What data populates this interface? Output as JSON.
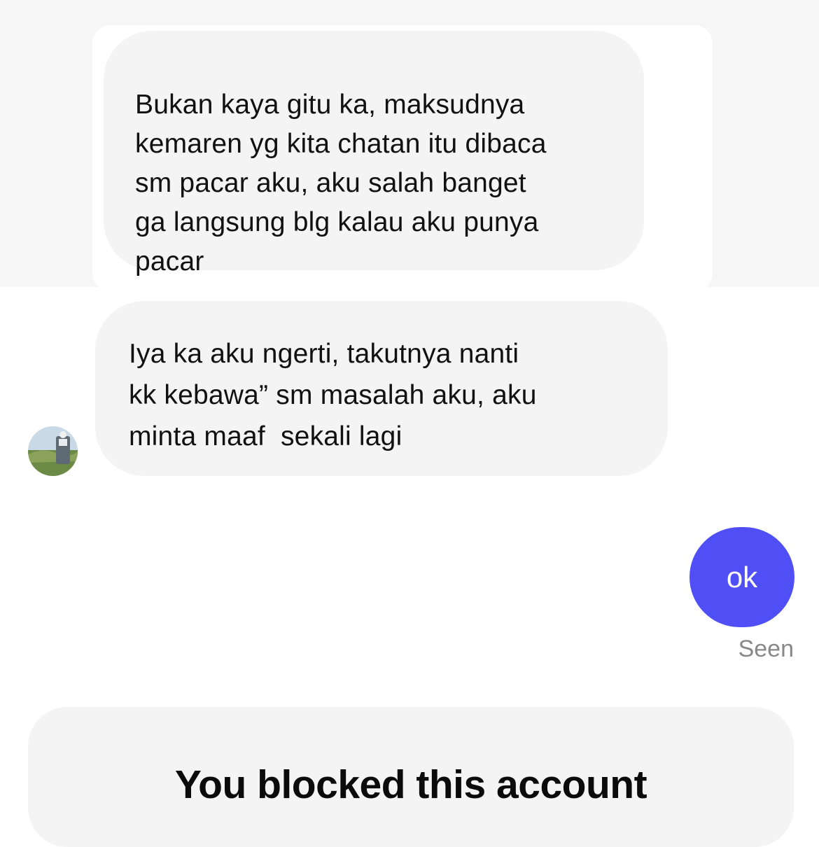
{
  "messages": [
    {
      "direction": "received",
      "quoted": true,
      "text": "Bukan kaya gitu ka, maksudnya\nkemaren yg kita chatan itu dibaca\nsm pacar aku, aku salah banget\nga langsung blg kalau aku punya\npacar"
    },
    {
      "direction": "received",
      "text": "Iya ka aku ngerti, takutnya nanti\nkk kebawa” sm masalah aku, aku\nminta maaf  sekali lagi"
    },
    {
      "direction": "sent",
      "text": "ok",
      "status": "Seen"
    }
  ],
  "blocked_notice": {
    "title": "You blocked this account"
  },
  "colors": {
    "sent_bubble": "#4f4ff5",
    "received_bubble": "#f4f4f4",
    "quoted_background": "#f6f6f6",
    "status_text": "#888888"
  },
  "icons": {
    "avatar": "contact-avatar-photo"
  }
}
